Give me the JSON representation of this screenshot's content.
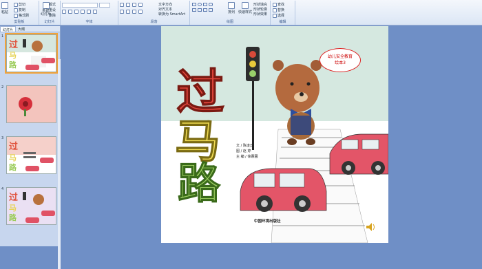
{
  "ribbon": {
    "clipboard": {
      "label": "剪贴板",
      "paste": "粘贴",
      "cut": "剪切",
      "copy": "复制",
      "format_painter": "格式刷"
    },
    "slides": {
      "label": "幻灯片",
      "new_slide": "新建\n幻灯片",
      "layout": "版式",
      "reset": "重设",
      "delete": "删除"
    },
    "font": {
      "label": "字体"
    },
    "paragraph": {
      "label": "段落",
      "text_direction": "文字方向",
      "align_text": "对齐文本",
      "smartart": "转换为 SmartArt"
    },
    "drawing": {
      "label": "绘图",
      "arrange": "排列",
      "quick_styles": "快速样式",
      "shape_fill": "形状填充",
      "shape_outline": "形状轮廓",
      "shape_effects": "形状效果"
    },
    "editing": {
      "label": "编辑",
      "find": "查找",
      "replace": "替换",
      "select": "选择"
    }
  },
  "pane": {
    "tab_slides": "幻灯片",
    "tab_outline": "大纲",
    "slide_numbers": [
      "1",
      "2",
      "3",
      "4"
    ]
  },
  "slide": {
    "title_chars": [
      "过",
      "马",
      "路"
    ],
    "badge_line1": "幼儿安全教育",
    "badge_line2": "绘本3",
    "credits": [
      "文 / 陈凌云",
      "图 / 赵 婷",
      "主 编 / 徐蕙圃"
    ],
    "publisher": "中国环境出版社"
  }
}
